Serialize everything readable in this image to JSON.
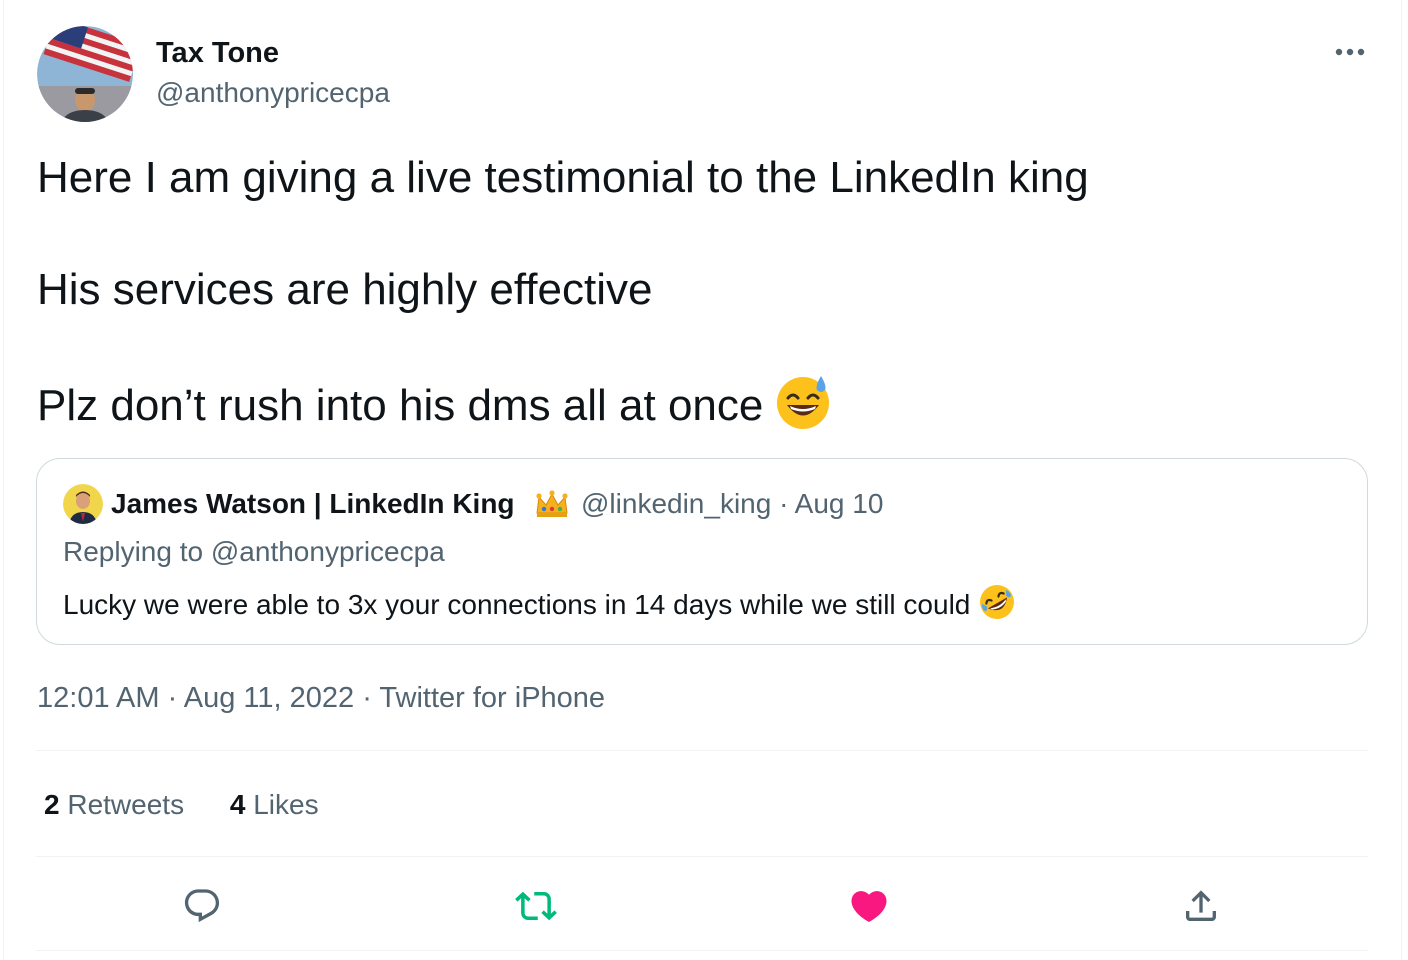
{
  "tweet": {
    "author": {
      "display_name": "Tax Tone",
      "handle": "@anthonypricecpa"
    },
    "text_lines": [
      "Here I am giving a live testimonial to the LinkedIn king",
      "His services are highly effective",
      "Plz don’t rush into his dms all at once"
    ],
    "text_emoji": "sweat-smile-emoji"
  },
  "quote": {
    "author_name": "James Watson | LinkedIn King",
    "author_badge": "crown-emoji",
    "handle": "@linkedin_king",
    "separator": "·",
    "date": "Aug 10",
    "replying_prefix": "Replying to",
    "replying_handle": "@anthonypricecpa",
    "text": "Lucky we were able to 3x your connections in 14 days while we still could",
    "text_emoji": "rolling-on-floor-laughing-emoji"
  },
  "meta": {
    "time": "12:01 AM",
    "date": "Aug 11, 2022",
    "source": "Twitter for iPhone",
    "separator": "·"
  },
  "stats": {
    "retweets_count": "2",
    "retweets_label": "Retweets",
    "likes_count": "4",
    "likes_label": "Likes"
  },
  "actions": {
    "reply_icon": "reply-icon",
    "retweet_icon": "retweet-icon",
    "like_icon": "heart-icon",
    "share_icon": "share-icon",
    "retweet_color": "#00ba7c",
    "like_color": "#f91880"
  },
  "colors": {
    "text_primary": "#0f1419",
    "text_secondary": "#536471",
    "border": "#cfd9de",
    "divider": "#eff3f4"
  }
}
